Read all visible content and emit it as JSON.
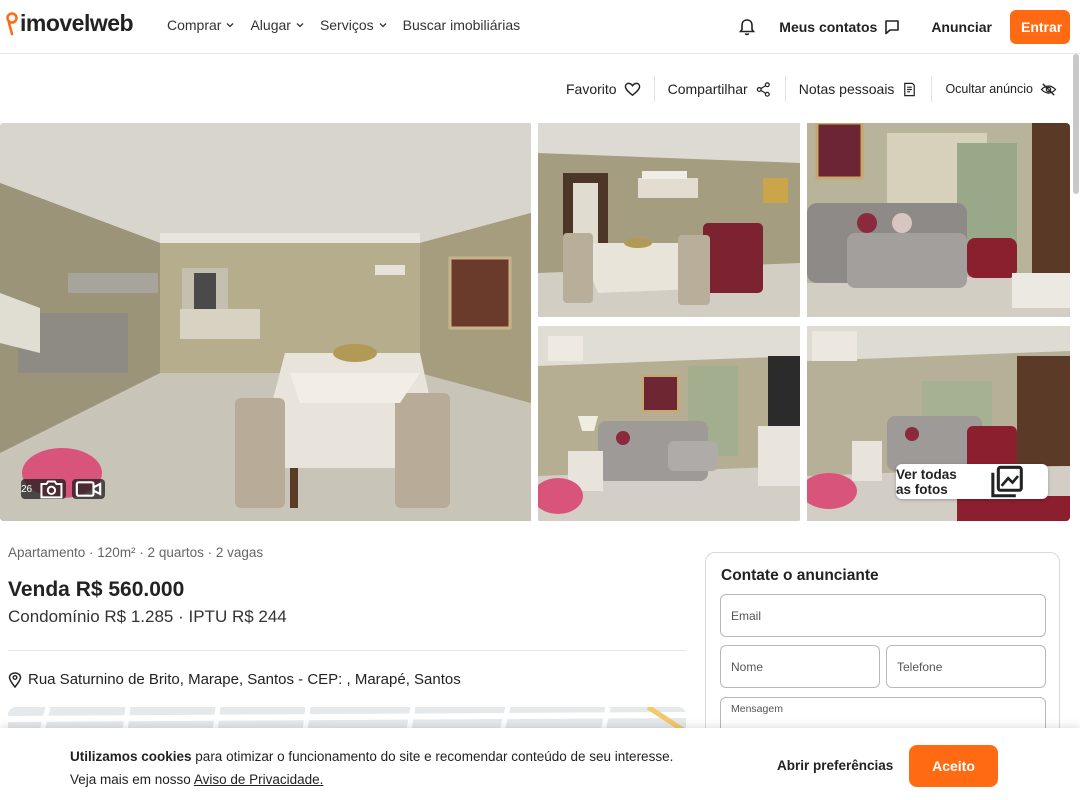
{
  "header": {
    "logo": "imovelweb",
    "nav": [
      {
        "label": "Comprar",
        "has_dropdown": true
      },
      {
        "label": "Alugar",
        "has_dropdown": true
      },
      {
        "label": "Serviços",
        "has_dropdown": true
      },
      {
        "label": "Buscar imobiliárias",
        "has_dropdown": false
      }
    ],
    "contacts_label": "Meus contatos",
    "anunciar_label": "Anunciar",
    "entrar_label": "Entrar",
    "accent_color": "#ff6a13"
  },
  "actions": {
    "favorito": "Favorito",
    "compartilhar": "Compartilhar",
    "notas": "Notas pessoais",
    "ocultar": "Ocultar anúncio"
  },
  "gallery": {
    "photo_count": "26",
    "ver_todas": "Ver todas as fotos"
  },
  "listing": {
    "summary": "Apartamento · 120m² · 2 quartos · 2 vagas",
    "price": "Venda R$ 560.000",
    "fees": "Condomínio R$ 1.285 · IPTU R$ 244",
    "address": "Rua Saturnino de Brito, Marape, Santos - CEP: , Marapé, Santos"
  },
  "contact_form": {
    "title": "Contate o anunciante",
    "email_label": "Email",
    "nome_label": "Nome",
    "telefone_label": "Telefone",
    "mensagem_label": "Mensagem"
  },
  "cookie_bar": {
    "bold": "Utilizamos cookies",
    "text": " para otimizar o funcionamento do site e recomendar conteúdo de seu interesse.",
    "line2_prefix": "Veja mais em nosso ",
    "privacy_link": "Aviso de Privacidade.",
    "prefs_label": "Abrir preferências",
    "accept_label": "Aceito"
  }
}
